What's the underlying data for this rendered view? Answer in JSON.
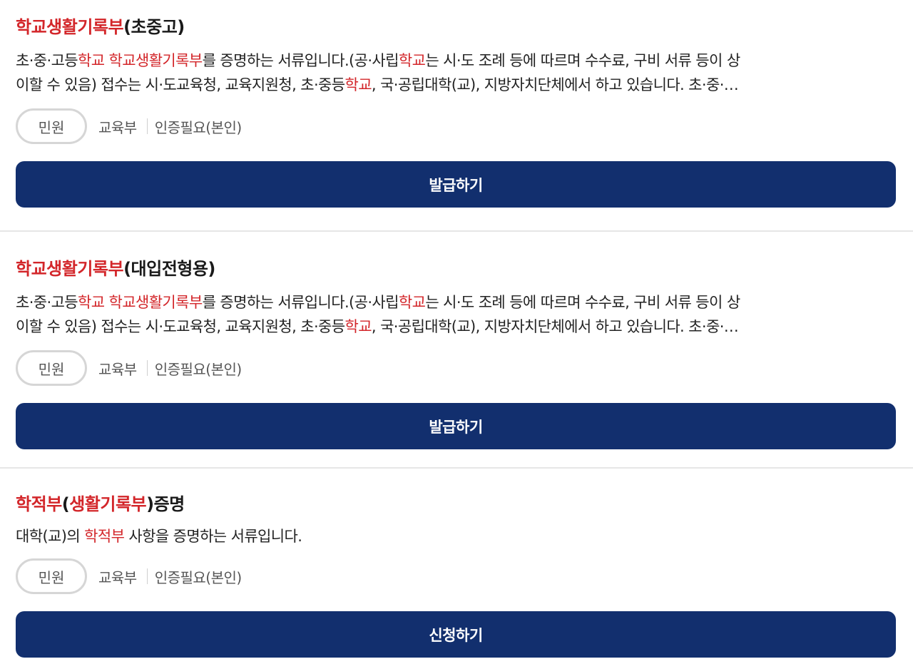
{
  "items": [
    {
      "title": {
        "hl": "학교생활기록부",
        "rest": "(초중고)"
      },
      "desc": {
        "l1_a": "초·중·고등",
        "l1_b": "학교 학교생활기록부",
        "l1_c": "를 증명하는 서류입니다.(공·사립",
        "l1_d": "학교",
        "l1_e": "는 시·도 조례 등에 따르며 수수료, 구비 서류 등이 상",
        "l2_a": "이할 수 있음) 접수는 시·도교육청, 교육지원청, 초·중등",
        "l2_b": "학교",
        "l2_c": ", 국·공립대학(교), 지방자치단체에서 하고 있습니다. 초·중·…"
      },
      "type_badge": "민원",
      "org": "교육부",
      "auth": "인증필요(본인)",
      "action": "발급하기"
    },
    {
      "title": {
        "hl": "학교생활기록부",
        "rest": "(대입전형용)"
      },
      "desc": {
        "l1_a": "초·중·고등",
        "l1_b": "학교 학교생활기록부",
        "l1_c": "를 증명하는 서류입니다.(공·사립",
        "l1_d": "학교",
        "l1_e": "는 시·도 조례 등에 따르며 수수료, 구비 서류 등이 상",
        "l2_a": "이할 수 있음) 접수는 시·도교육청, 교육지원청, 초·중등",
        "l2_b": "학교",
        "l2_c": ", 국·공립대학(교), 지방자치단체에서 하고 있습니다. 초·중·…"
      },
      "type_badge": "민원",
      "org": "교육부",
      "auth": "인증필요(본인)",
      "action": "발급하기"
    },
    {
      "title": {
        "a": "학적부",
        "b": "(",
        "c": "생활기록부",
        "d": ")증명"
      },
      "desc": {
        "a": "대학(교)의 ",
        "b": "학적부",
        "c": " 사항을 증명하는 서류입니다."
      },
      "type_badge": "민원",
      "org": "교육부",
      "auth": "인증필요(본인)",
      "action": "신청하기"
    }
  ],
  "colors": {
    "highlight": "#d3262a",
    "button_bg": "#122f6e",
    "button_text": "#ffffff",
    "badge_border": "#d6d6d6",
    "divider": "#e6e6e6"
  }
}
